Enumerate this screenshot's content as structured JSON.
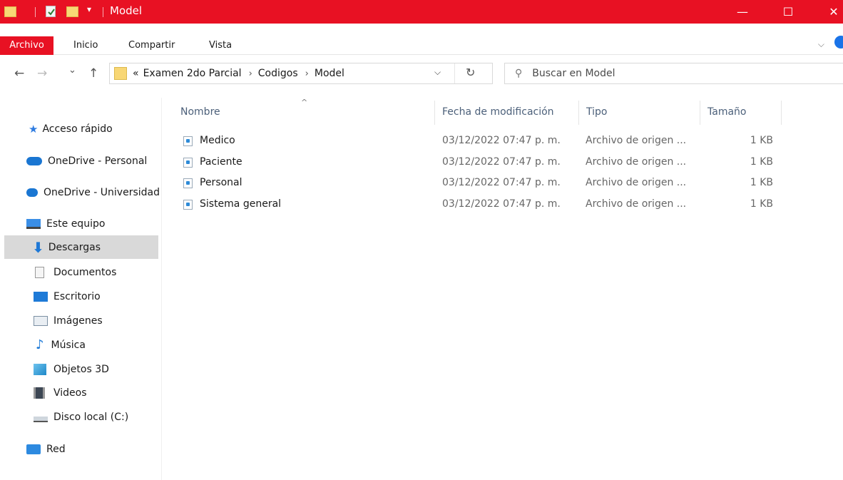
{
  "window": {
    "title": "Model",
    "dropdown_glyph": "▾",
    "minimize": "—",
    "maximize": "☐",
    "close": "✕"
  },
  "ribbon": {
    "tabs": [
      "Archivo",
      "Inicio",
      "Compartir",
      "Vista"
    ],
    "chevron": "⌵",
    "active_color": "#e81123"
  },
  "nav": {
    "back": "←",
    "forward": "→",
    "recent": "⌄",
    "up": "↑",
    "breadcrumb_prefix": "«",
    "breadcrumb": [
      "Examen 2do Parcial",
      "Codigos",
      "Model"
    ],
    "breadcrumb_sep": "›",
    "address_dropdown": "⌵",
    "refresh": "↻",
    "search_icon": "⚲",
    "search_placeholder": "Buscar en Model"
  },
  "sidebar": {
    "items": [
      {
        "label": "Acceso rápido",
        "icon": "star-icon"
      },
      {
        "label": "OneDrive - Personal",
        "icon": "cloud-icon"
      },
      {
        "label": "OneDrive - Universidad",
        "icon": "cloud-icon"
      },
      {
        "label": "Este equipo",
        "icon": "computer-icon"
      },
      {
        "label": "Descargas",
        "icon": "download-arrow-icon",
        "selected": true
      },
      {
        "label": "Documentos",
        "icon": "document-icon"
      },
      {
        "label": "Escritorio",
        "icon": "desktop-icon"
      },
      {
        "label": "Imágenes",
        "icon": "pictures-icon"
      },
      {
        "label": "Música",
        "icon": "music-note-icon"
      },
      {
        "label": "Objetos 3D",
        "icon": "cube-icon"
      },
      {
        "label": "Videos",
        "icon": "film-icon"
      },
      {
        "label": "Disco local (C:)",
        "icon": "drive-icon"
      },
      {
        "label": "Red",
        "icon": "network-icon"
      }
    ]
  },
  "columns": {
    "name": "Nombre",
    "date": "Fecha de modificación",
    "type": "Tipo",
    "size": "Tamaño",
    "sort_caret": "^"
  },
  "files": [
    {
      "name": "Medico",
      "date": "03/12/2022 07:47 p. m.",
      "type": "Archivo de origen ...",
      "size": "1 KB"
    },
    {
      "name": "Paciente",
      "date": "03/12/2022 07:47 p. m.",
      "type": "Archivo de origen ...",
      "size": "1 KB"
    },
    {
      "name": "Personal",
      "date": "03/12/2022 07:47 p. m.",
      "type": "Archivo de origen ...",
      "size": "1 KB"
    },
    {
      "name": "Sistema general",
      "date": "03/12/2022 07:47 p. m.",
      "type": "Archivo de origen ...",
      "size": "1 KB"
    }
  ]
}
